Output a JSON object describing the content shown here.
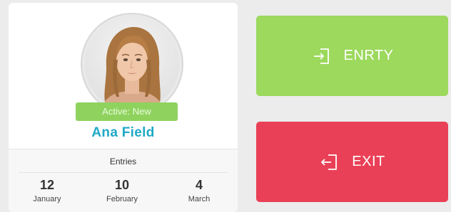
{
  "profile": {
    "status": "Active: New",
    "name": "Ana Field"
  },
  "stats": {
    "title": "Entries",
    "items": [
      {
        "value": "12",
        "month": "January"
      },
      {
        "value": "10",
        "month": "February"
      },
      {
        "value": "4",
        "month": "March"
      }
    ]
  },
  "actions": {
    "entry_label": "ENRTY",
    "exit_label": "EXIT"
  },
  "colors": {
    "entry": "#9cd95d",
    "exit": "#ea4057",
    "badge": "#8fd35e",
    "name": "#1fa9c6"
  },
  "icons": {
    "entry": "login-icon",
    "exit": "logout-icon"
  }
}
